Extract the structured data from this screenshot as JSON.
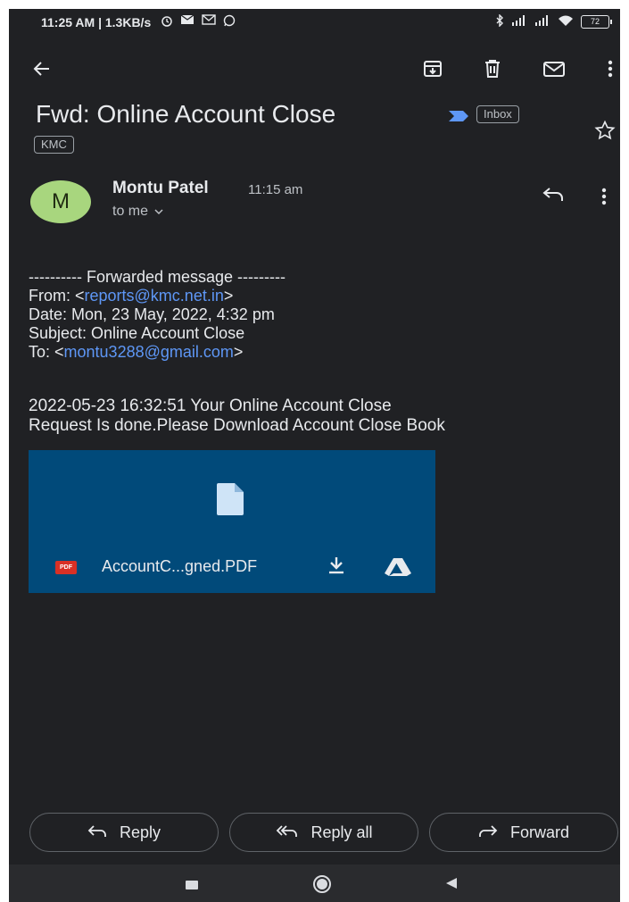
{
  "status_bar": {
    "time_speed": "11:25 AM | 1.3KB/s",
    "battery": "72",
    "icons_left": [
      "alarm-icon",
      "mail-icon",
      "gmail-icon",
      "whatsapp-icon"
    ],
    "icons_right": [
      "bluetooth-icon",
      "signal-icon",
      "signal-icon",
      "wifi-icon",
      "battery-icon"
    ]
  },
  "toolbar": {
    "icons": [
      "back-arrow-icon",
      "archive-icon",
      "delete-icon",
      "mark-unread-icon",
      "more-vert-icon"
    ]
  },
  "email": {
    "subject": "Fwd: Online Account Close",
    "labels": [
      "Inbox",
      "KMC"
    ],
    "sender": {
      "avatar_letter": "M",
      "name": "Montu Patel",
      "time": "11:15 am",
      "recipient": "to me"
    },
    "forwarded": {
      "header": "---------- Forwarded message ---------",
      "from_label": "From: <",
      "from_email": "reports@kmc.net.in",
      "from_close": ">",
      "date": "Date: Mon, 23 May, 2022, 4:32 pm",
      "subject": "Subject: Online Account Close",
      "to_label": "To: <",
      "to_email": "montu3288@gmail.com",
      "to_close": ">"
    },
    "message_line1": "2022-05-23 16:32:51 Your Online Account Close",
    "message_line2": "Request Is done.Please Download Account Close Book",
    "attachment": {
      "type_badge": "PDF",
      "filename": "AccountC...gned.PDF"
    }
  },
  "actions": {
    "reply": "Reply",
    "reply_all": "Reply all",
    "forward": "Forward"
  },
  "colors": {
    "background": "#202124",
    "link": "#5e97f6",
    "attachment_bg": "#014a7a",
    "avatar_bg": "#a8d67e",
    "importance_marker": "#5e97f6"
  }
}
